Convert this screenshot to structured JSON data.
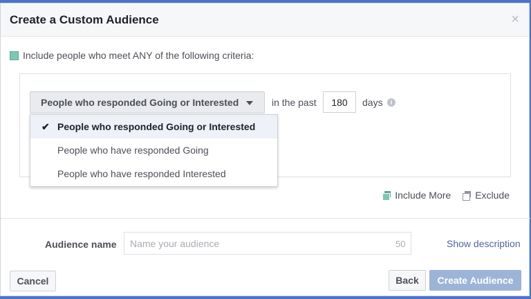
{
  "dialog": {
    "title": "Create a Custom Audience",
    "close_symbol": "×"
  },
  "criteria": {
    "text": "Include people who meet ANY of the following criteria:",
    "swatch_color": "#7cc8b5"
  },
  "rule": {
    "selected_event": "People who responded Going or Interested",
    "in_past_label": "in the past",
    "days_value": "180",
    "days_label": "days",
    "info_symbol": "i"
  },
  "dropdown": {
    "check_symbol": "✔",
    "options": [
      {
        "label": "People who responded Going or Interested",
        "selected": true
      },
      {
        "label": "People who have responded Going",
        "selected": false
      },
      {
        "label": "People who have responded Interested",
        "selected": false
      }
    ]
  },
  "rule_actions": {
    "include_more": "Include More",
    "exclude": "Exclude"
  },
  "audience_name": {
    "label": "Audience name",
    "placeholder": "Name your audience",
    "char_limit": "50",
    "show_description": "Show description"
  },
  "footer": {
    "cancel": "Cancel",
    "back": "Back",
    "create": "Create Audience"
  },
  "colors": {
    "accent_blue": "#4b67a1",
    "create_button_disabled": "#9cb4d8",
    "backdrop": "#4a73c9"
  },
  "icons": [
    "close-icon",
    "chevron-down-icon",
    "info-icon",
    "check-icon",
    "include-more-icon",
    "exclude-icon"
  ]
}
